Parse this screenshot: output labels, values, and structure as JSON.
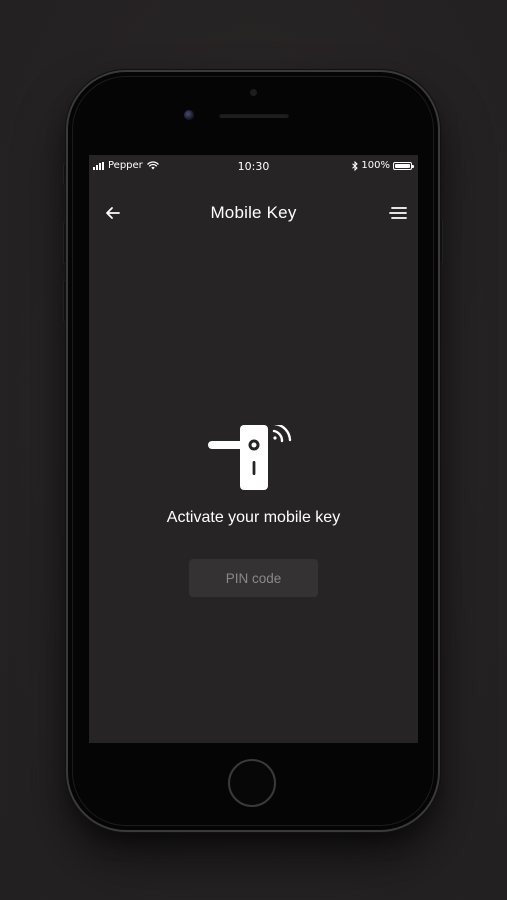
{
  "status_bar": {
    "carrier": "Pepper",
    "time": "10:30",
    "battery": "100%",
    "battery_level": 1.0
  },
  "nav": {
    "title": "Mobile Key",
    "back_icon": "arrow-left-icon",
    "menu_icon": "hamburger-menu-icon"
  },
  "main": {
    "icon": "door-handle-wireless-icon",
    "headline": "Activate your mobile key",
    "pin_button_label": "PIN code"
  },
  "colors": {
    "background": "#272425",
    "button_bg": "#353233",
    "button_text": "#8b8889",
    "text": "#ffffff"
  }
}
